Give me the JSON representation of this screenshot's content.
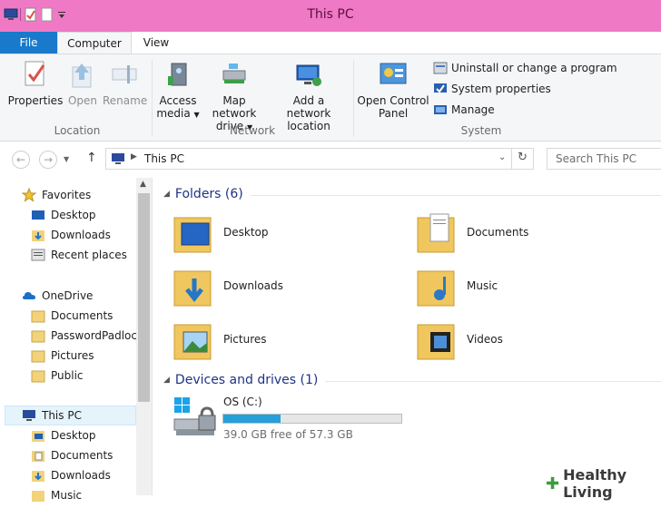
{
  "window": {
    "title": "This PC"
  },
  "tabs": {
    "file": "File",
    "computer": "Computer",
    "view": "View"
  },
  "ribbon": {
    "location": {
      "label": "Location",
      "properties": "Properties",
      "open": "Open",
      "rename": "Rename"
    },
    "network": {
      "label": "Network",
      "access_media_1": "Access",
      "access_media_2": "media",
      "map_drive_1": "Map network",
      "map_drive_2": "drive",
      "add_location_1": "Add a network",
      "add_location_2": "location"
    },
    "system": {
      "label": "System",
      "open_cp_1": "Open Control",
      "open_cp_2": "Panel",
      "uninstall": "Uninstall or change a program",
      "system_properties": "System properties",
      "manage": "Manage"
    }
  },
  "address": {
    "path": "This PC",
    "search_placeholder": "Search This PC"
  },
  "nav": {
    "favorites": "Favorites",
    "fav_items": [
      "Desktop",
      "Downloads",
      "Recent places"
    ],
    "onedrive": "OneDrive",
    "od_items": [
      "Documents",
      "PasswordPadlock",
      "Pictures",
      "Public"
    ],
    "thispc": "This PC",
    "pc_items": [
      "Desktop",
      "Documents",
      "Downloads",
      "Music"
    ]
  },
  "content": {
    "folders_header": "Folders (6)",
    "folders": [
      "Desktop",
      "Documents",
      "Downloads",
      "Music",
      "Pictures",
      "Videos"
    ],
    "devices_header": "Devices and drives (1)",
    "drive": {
      "name": "OS (C:)",
      "free_text": "39.0 GB free of 57.3 GB",
      "used_fraction": 0.32
    }
  },
  "watermark": "Healthy Living",
  "colors": {
    "titlebar": "#ef79c5",
    "file_tab": "#1979ca",
    "progress": "#26a0da",
    "section_header": "#1e3287"
  }
}
